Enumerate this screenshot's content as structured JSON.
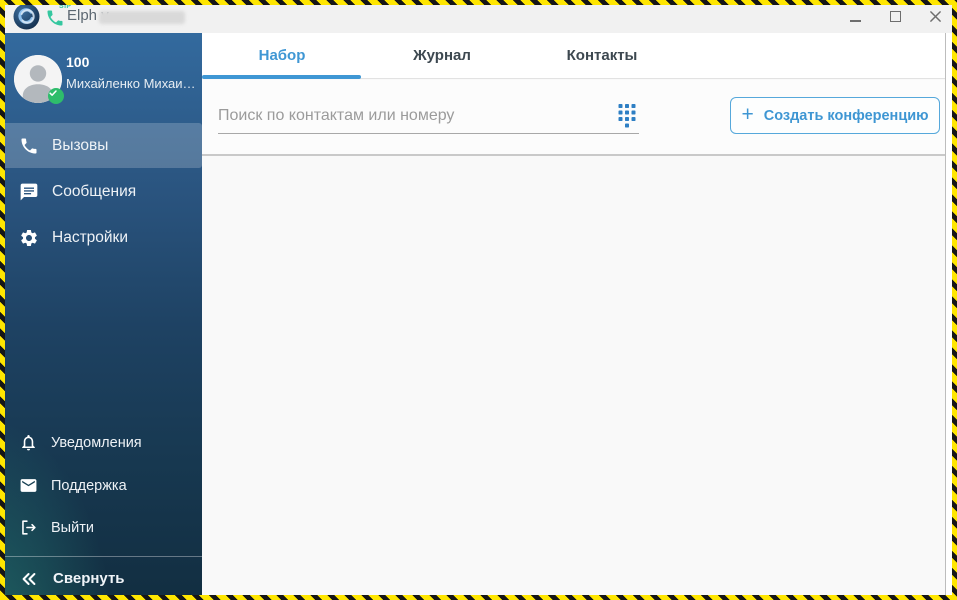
{
  "titlebar": {
    "title": "Elph v.",
    "sip_label": "SIP",
    "version_redacted": true
  },
  "sidebar": {
    "user": {
      "extension": "100",
      "name": "Михайленко Михаи…",
      "status": "online"
    },
    "items": [
      {
        "label": "Вызовы",
        "icon": "phone-icon",
        "active": true
      },
      {
        "label": "Сообщения",
        "icon": "chat-icon",
        "active": false
      },
      {
        "label": "Настройки",
        "icon": "gear-icon",
        "active": false
      }
    ],
    "footer_items": [
      {
        "label": "Уведомления",
        "icon": "bell-icon"
      },
      {
        "label": "Поддержка",
        "icon": "envelope-icon"
      },
      {
        "label": "Выйти",
        "icon": "logout-icon"
      }
    ],
    "collapse": {
      "label": "Свернуть",
      "icon": "double-chevron-left-icon"
    }
  },
  "main": {
    "tabs": [
      {
        "label": "Набор",
        "active": true
      },
      {
        "label": "Журнал",
        "active": false
      },
      {
        "label": "Контакты",
        "active": false
      }
    ],
    "search": {
      "value": "",
      "placeholder": "Поиск по контактам или номеру",
      "icon": "dialpad-icon"
    },
    "create_conference": {
      "plus_glyph": "+",
      "label": "Создать конференцию"
    }
  },
  "icons": {
    "app_logo": "swirl-logo-icon",
    "sip": "sip-phone-icon",
    "avatar": "person-silhouette-icon",
    "online_badge": "check-badge-icon",
    "minimize": "minimize-icon",
    "maximize": "maximize-icon",
    "close": "close-icon"
  },
  "colors": {
    "accent_blue": "#3f97d4",
    "sidebar_top": "#336a9e",
    "sidebar_bottom": "#122e41",
    "sidebar_teal_glow": "#2e9e8a",
    "active_item_overlay": "rgba(255,255,255,0.2)",
    "sip_green": "#35c79f",
    "online_green": "#2ebd6b",
    "titlebar_bg": "#f1f1f1",
    "frame_yellow": "#ffe600",
    "frame_black": "#161616"
  }
}
